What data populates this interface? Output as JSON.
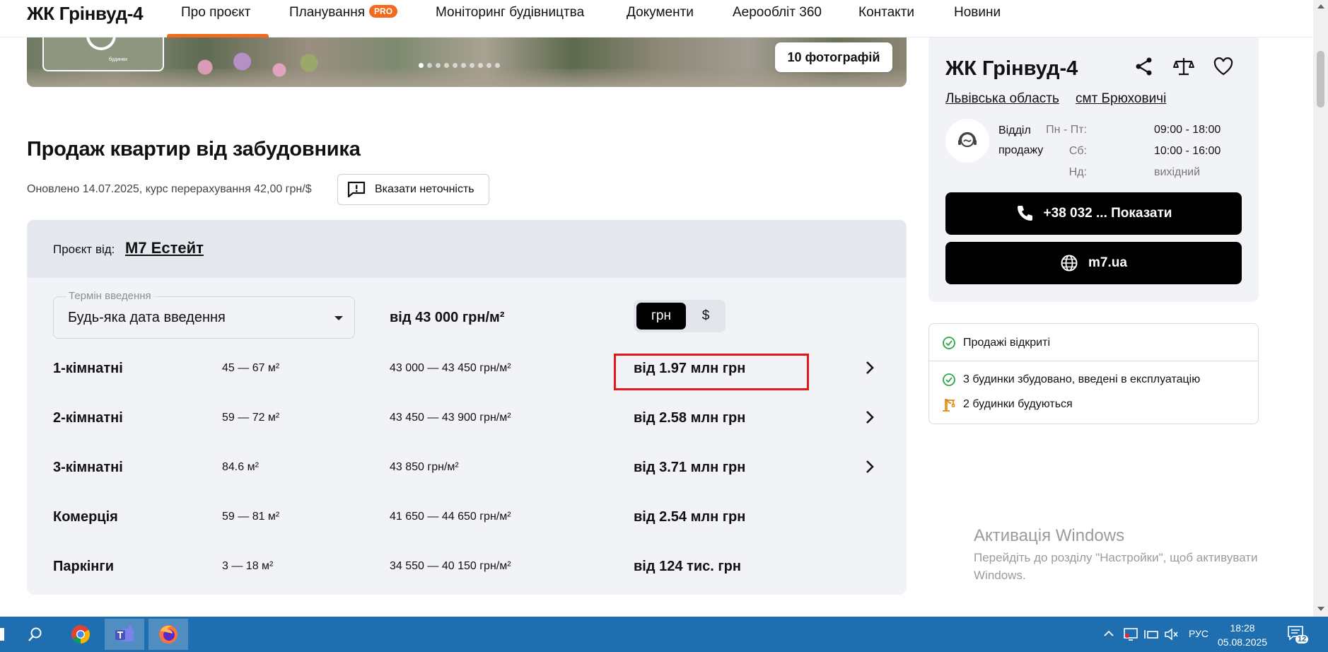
{
  "nav": {
    "logo": "ЖК Грінвуд-4",
    "items": [
      {
        "label": "Про проєкт"
      },
      {
        "label": "Планування",
        "badge": "PRO"
      },
      {
        "label": "Моніторинг будівництва"
      },
      {
        "label": "Документи"
      },
      {
        "label": "Аерообліт 360"
      },
      {
        "label": "Контакти"
      },
      {
        "label": "Новини"
      }
    ]
  },
  "hero": {
    "photos_button": "10 фотографій",
    "thumb_text": "будинки",
    "slide_count": 10,
    "active_slide": 1
  },
  "section": {
    "title": "Продаж квартир від забудовника",
    "updated": "Оновлено 14.07.2025, курс перерахування 42,00 грн/$",
    "report_button": "Вказати неточність"
  },
  "table": {
    "project_by_label": "Проєкт від:",
    "developer": "M7 Естейт",
    "filter_legend": "Термін введення",
    "filter_value": "Будь-яка дата введення",
    "min_price": "від 43 000 грн/м²",
    "currency": {
      "options": [
        "грн",
        "$"
      ],
      "selected": "грн"
    },
    "rows": [
      {
        "type": "1-кімнатні",
        "area": "45 — 67 м²",
        "price_per_m2": "43 000 — 43 450 грн/м²",
        "price": "від 1.97 млн грн",
        "has_arrow": true
      },
      {
        "type": "2-кімнатні",
        "area": "59 — 72 м²",
        "price_per_m2": "43 450 — 43 900 грн/м²",
        "price": "від 2.58 млн грн",
        "has_arrow": true
      },
      {
        "type": "3-кімнатні",
        "area": "84.6 м²",
        "price_per_m2": "43 850 грн/м²",
        "price": "від 3.71 млн грн",
        "has_arrow": true
      },
      {
        "type": "Комерція",
        "area": "59 — 81 м²",
        "price_per_m2": "41 650 — 44 650 грн/м²",
        "price": "від 2.54 млн грн",
        "has_arrow": false
      },
      {
        "type": "Паркінги",
        "area": "3 — 18 м²",
        "price_per_m2": "34 550 — 40 150 грн/м²",
        "price": "від 124 тис. грн",
        "has_arrow": false
      }
    ]
  },
  "info": {
    "title": "ЖК Грінвуд-4",
    "region": "Львівська область",
    "town": "смт Брюховичі",
    "department_line1": "Відділ",
    "department_line2": "продажу",
    "hours": [
      {
        "label": "Пн - Пт:",
        "value": "09:00 - 18:00"
      },
      {
        "label": "Сб:",
        "value": "10:00 - 16:00"
      },
      {
        "label": "Нд:",
        "value": "вихідний"
      }
    ],
    "phone_button": "+38 032 ... Показати",
    "website_button": "m7.ua"
  },
  "status": {
    "sales": "Продажі відкриті",
    "built": "3 будинки збудовано, введені в експлуатацію",
    "building": "2 будинки будуються"
  },
  "activation": {
    "title": "Активація Windows",
    "text": "Перейдіть до розділу \"Настройки\", щоб активувати Windows."
  },
  "taskbar": {
    "lang": "РУС",
    "time": "18:28",
    "date": "05.08.2025",
    "notifications": "12"
  },
  "colors": {
    "accent": "#f26b1d",
    "highlight": "#e01818",
    "card_bg": "#f2f3f6",
    "taskbar": "#1f6fb0"
  }
}
